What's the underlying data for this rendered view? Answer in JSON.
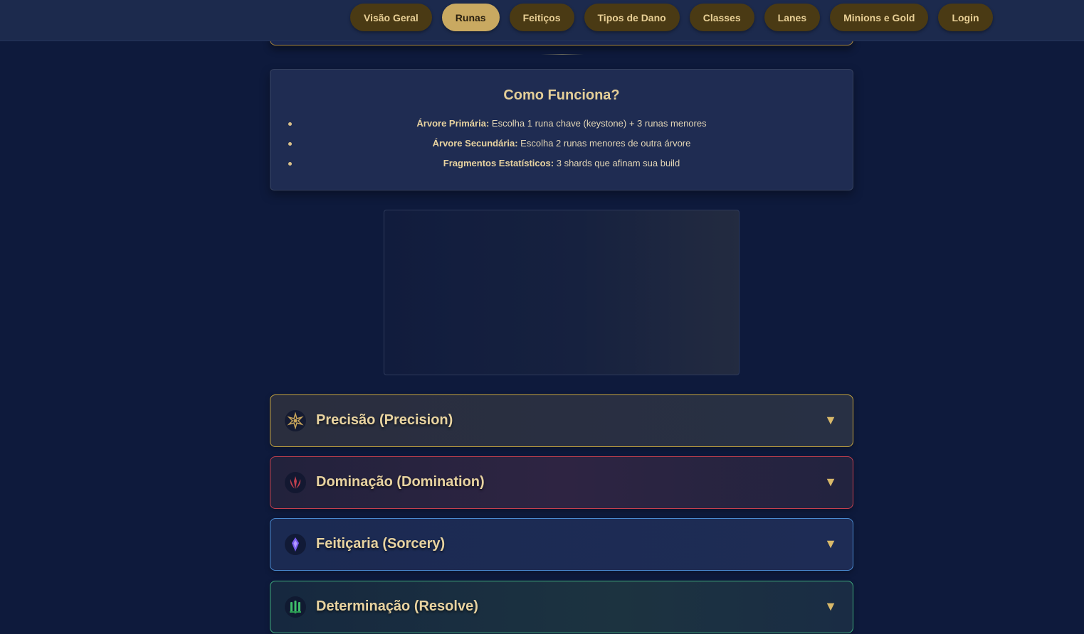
{
  "nav": {
    "items": [
      {
        "label": "Visão Geral",
        "active": false
      },
      {
        "label": "Runas",
        "active": true
      },
      {
        "label": "Feitiços",
        "active": false
      },
      {
        "label": "Tipos de Dano",
        "active": false
      },
      {
        "label": "Classes",
        "active": false
      },
      {
        "label": "Lanes",
        "active": false
      },
      {
        "label": "Minions e Gold",
        "active": false
      },
      {
        "label": "Login",
        "active": false
      }
    ]
  },
  "how_it_works": {
    "title": "Como Funciona?",
    "items": [
      {
        "term": "Árvore Primária:",
        "text": " Escolha 1 runa chave (keystone) + 3 runas menores"
      },
      {
        "term": "Árvore Secundária:",
        "text": " Escolha 2 runas menores de outra árvore"
      },
      {
        "term": "Fragmentos Estatísticos:",
        "text": " 3 shards que afinam sua build"
      }
    ]
  },
  "rune_trees": [
    {
      "title": "Precisão (Precision)",
      "icon": "precision-icon",
      "accent": "#c5a43e",
      "chevron": "▼"
    },
    {
      "title": "Dominação (Domination)",
      "icon": "domination-icon",
      "accent": "#c5404e",
      "chevron": "▼"
    },
    {
      "title": "Feitiçaria (Sorcery)",
      "icon": "sorcery-icon",
      "accent": "#4a8ad0",
      "chevron": "▼"
    },
    {
      "title": "Determinação (Resolve)",
      "icon": "resolve-icon",
      "accent": "#3fae7f",
      "chevron": "▼"
    }
  ],
  "colors": {
    "background": "#0e1a3c",
    "nav_button": "#4a3a14",
    "nav_active": "#c9a961",
    "gold_text": "#e8d3a0"
  }
}
